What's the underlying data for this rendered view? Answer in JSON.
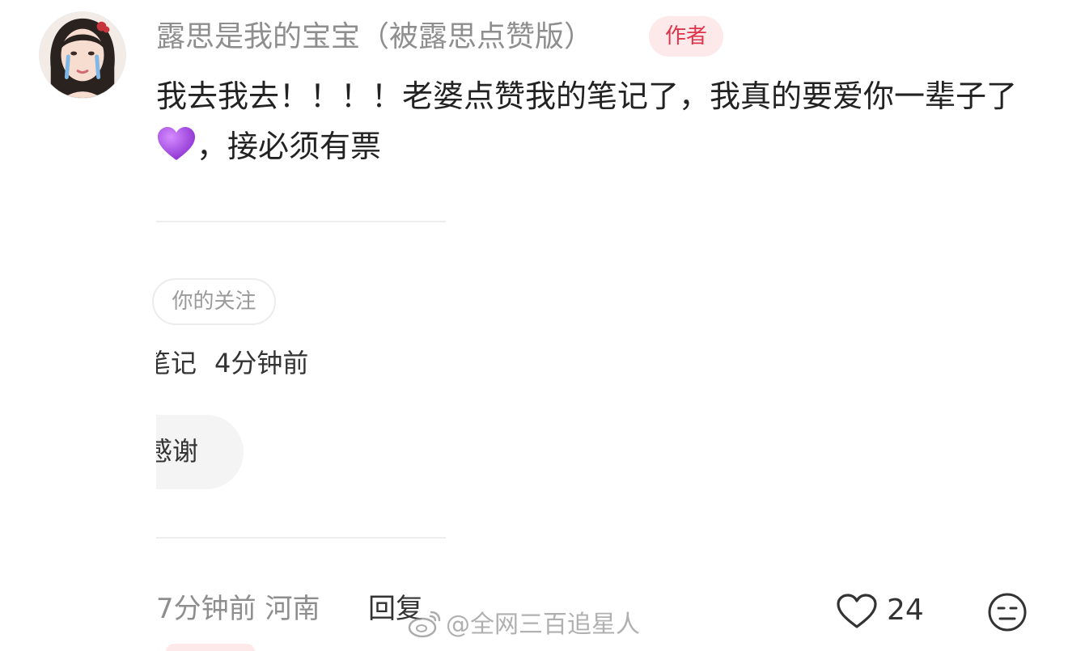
{
  "comment": {
    "username": "露思是我的宝宝（被露思点赞版）",
    "author_badge": "作者",
    "text_before_emoji": "我去我去！！！！老婆点赞我的笔记了，我真的要爱你一辈子了",
    "emoji": "purple-heart",
    "text_after_emoji": "，接必须有票"
  },
  "card": {
    "follow_chip": "你的关注",
    "type_label": "笔记",
    "time": "4分钟前",
    "thanks_text": "感谢"
  },
  "footer": {
    "time_location": "7分钟前 河南",
    "reply_label": "回复",
    "like_count": "24"
  },
  "watermark": "@全网三百追星人",
  "colors": {
    "accent": "#e0344a",
    "badge_bg": "#fde8ea",
    "heart": "#a64ee0",
    "muted_text": "#8e8e8e"
  }
}
